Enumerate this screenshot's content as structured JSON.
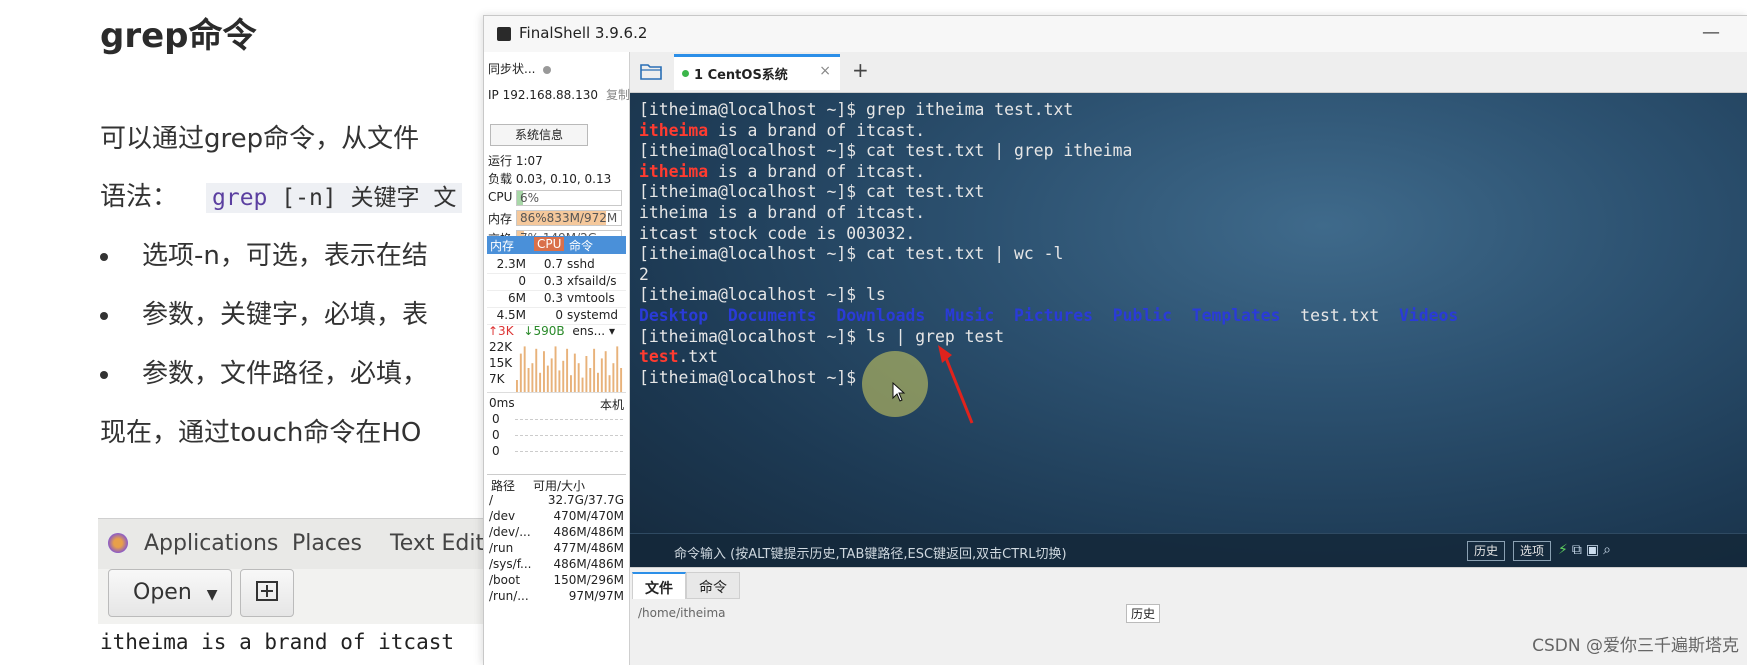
{
  "doc": {
    "title": "grep命令",
    "intro": "可以通过grep命令，从文件",
    "syntax_label": "语法：",
    "syntax_cmd": "grep",
    "syntax_args": " [-n] 关键字 文",
    "bullets": [
      "选项-n，可选，表示在结",
      "参数，关键字，必填，表",
      "参数，文件路径，必填，"
    ],
    "now_line": "现在，通过touch命令在HO"
  },
  "gedit": {
    "menu": [
      "Applications",
      "Places",
      "Text Edito"
    ],
    "open_label": "Open",
    "text_line": "itheima is a brand of itcast"
  },
  "window": {
    "title": "FinalShell 3.9.6.2",
    "minimize": "—"
  },
  "left_panel": {
    "sync": "同步状...",
    "ip_label": "IP 192.168.88.130",
    "copy": "复制",
    "sysinfo_button": "系统信息",
    "uptime": "运行 1:07",
    "load": "负载 0.03, 0.10, 0.13",
    "meters": [
      {
        "label": "CPU",
        "text": "6%",
        "value": 0.06,
        "color": "#a8d8a8"
      },
      {
        "label": "内存",
        "text": "86%833M/972M",
        "value": 0.86,
        "color": "#f5c89b"
      },
      {
        "label": "交换",
        "text": "7%     149M/2G",
        "value": 0.07,
        "color": "#f5c89b"
      }
    ],
    "proc_headers": [
      "内存",
      "CPU",
      "命令"
    ],
    "processes": [
      {
        "mem": "2.3M",
        "cpu": "0.7",
        "cmd": "sshd"
      },
      {
        "mem": "0",
        "cpu": "0.3",
        "cmd": "xfsaild/s"
      },
      {
        "mem": "6M",
        "cpu": "0.3",
        "cmd": "vmtools"
      },
      {
        "mem": "4.5M",
        "cpu": "0",
        "cmd": "systemd"
      }
    ],
    "net_up": "↑3K",
    "net_down": "↓590B",
    "net_iface": "ens...",
    "net_y": [
      "22K",
      "15K",
      "7K"
    ],
    "net_bars": [
      0.25,
      0.8,
      0.95,
      0.5,
      0.6,
      0.9,
      0.4,
      0.85,
      0.55,
      0.7,
      0.95,
      0.45,
      0.65,
      0.9,
      0.35,
      0.8,
      0.6,
      0.3,
      0.75,
      0.5,
      0.9,
      0.4,
      0.7,
      0.85,
      0.35,
      0.6,
      0.95,
      0.5
    ],
    "ping_label": "0ms",
    "ping_host": "本机",
    "ping_values": [
      "0",
      "0",
      "0"
    ],
    "disk_headers": [
      "路径",
      "可用/大小"
    ],
    "disks": [
      {
        "path": "/",
        "size": "32.7G/37.7G"
      },
      {
        "path": "/dev",
        "size": "470M/470M"
      },
      {
        "path": "/dev/...",
        "size": "486M/486M"
      },
      {
        "path": "/run",
        "size": "477M/486M"
      },
      {
        "path": "/sys/f...",
        "size": "486M/486M"
      },
      {
        "path": "/boot",
        "size": "150M/296M"
      },
      {
        "path": "/run/...",
        "size": "97M/97M"
      }
    ]
  },
  "tabs": [
    {
      "label": "1 CentOS系统",
      "close": "×"
    }
  ],
  "tab_add": "+",
  "terminal": {
    "prompt": "[itheima@localhost ~]$ ",
    "l1_cmd": "grep itheima test.txt",
    "l2_hl": "itheima",
    "l2_rest": " is a brand of itcast.",
    "l3_cmd": "cat test.txt | grep itheima",
    "l4_hl": "itheima",
    "l4_rest": " is a brand of itcast.",
    "l5_cmd": "cat test.txt",
    "l6": "itheima is a brand of itcast.",
    "l7": "itcast stock code is 003032.",
    "l8_cmd": "cat test.txt | wc -l",
    "l9": "2",
    "l10_cmd": "ls",
    "ls_dirs": [
      "Desktop",
      "Documents",
      "Downloads",
      "Music",
      "Pictures",
      "Public",
      "Templates"
    ],
    "ls_file": "test.txt",
    "ls_last_dir": "Videos",
    "l12_cmd": "ls | grep test",
    "l13_hl": "test",
    "l13_rest": ".txt"
  },
  "cmd_bar": {
    "hint": "命令输入 (按ALT键提示历史,TAB键路径,ESC键返回,双击CTRL切换)",
    "history": "历史",
    "options": "选项"
  },
  "bottom": {
    "tabs": [
      "文件",
      "命令"
    ],
    "path": "/home/itheima",
    "history": "历史"
  },
  "watermark": "CSDN @爱你三千遍斯塔克"
}
